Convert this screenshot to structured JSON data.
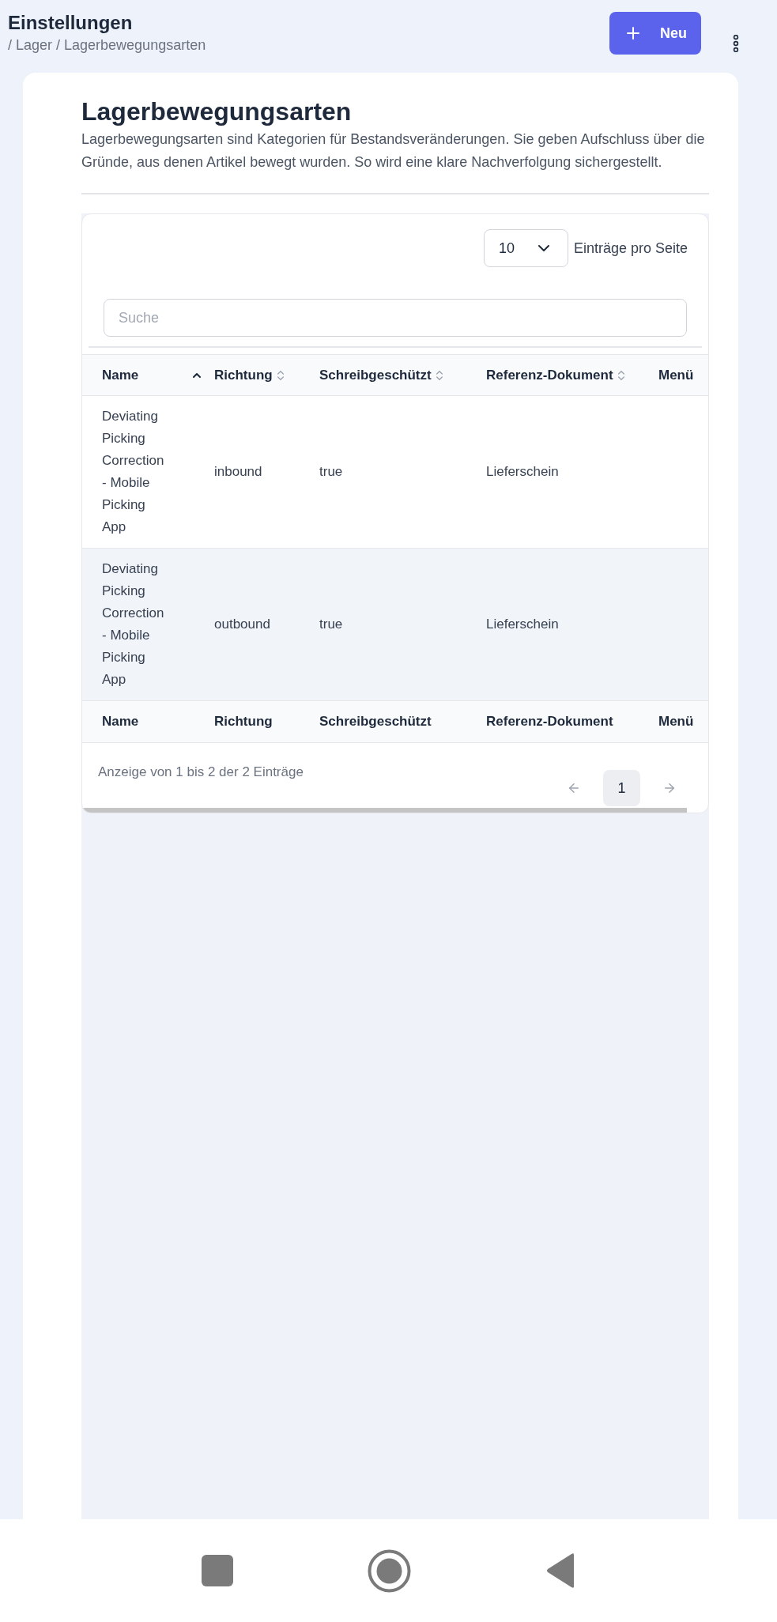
{
  "header": {
    "title": "Einstellungen",
    "breadcrumb": "/ Lager / Lagerbewegungsarten",
    "new_button": "Neu"
  },
  "page": {
    "title": "Lagerbewegungsarten",
    "description": "Lagerbewegungsarten sind Kategorien für Bestandsveränderungen. Sie geben Aufschluss über die Gründe, aus denen Artikel bewegt wurden. So wird eine klare Nachverfolgung sichergestellt."
  },
  "table": {
    "page_size": "10",
    "page_size_label": "Einträge pro Seite",
    "search": {
      "placeholder": "Suche"
    },
    "columns": [
      {
        "label": "Name",
        "sortable": true,
        "sorted": true
      },
      {
        "label": "Richtung",
        "sortable": true,
        "sorted": false
      },
      {
        "label": "Schreibgeschützt",
        "sortable": true,
        "sorted": false
      },
      {
        "label": "Referenz-Dokument",
        "sortable": true,
        "sorted": false
      },
      {
        "label": "Menü",
        "sortable": false,
        "sorted": false
      }
    ],
    "rows": [
      {
        "cells": [
          "Deviating Picking Correction - Mobile Picking App",
          "inbound",
          "true",
          "Lieferschein"
        ]
      },
      {
        "cells": [
          "Deviating Picking Correction - Mobile Picking App",
          "outbound",
          "true",
          "Lieferschein"
        ]
      }
    ],
    "footer_columns": [
      "Name",
      "Richtung",
      "Schreibgeschützt",
      "Referenz-Dokument",
      "Menü"
    ],
    "summary": "Anzeige von 1 bis 2 der 2 Einträge",
    "pages": [
      {
        "label": "1",
        "selected": true
      }
    ]
  }
}
